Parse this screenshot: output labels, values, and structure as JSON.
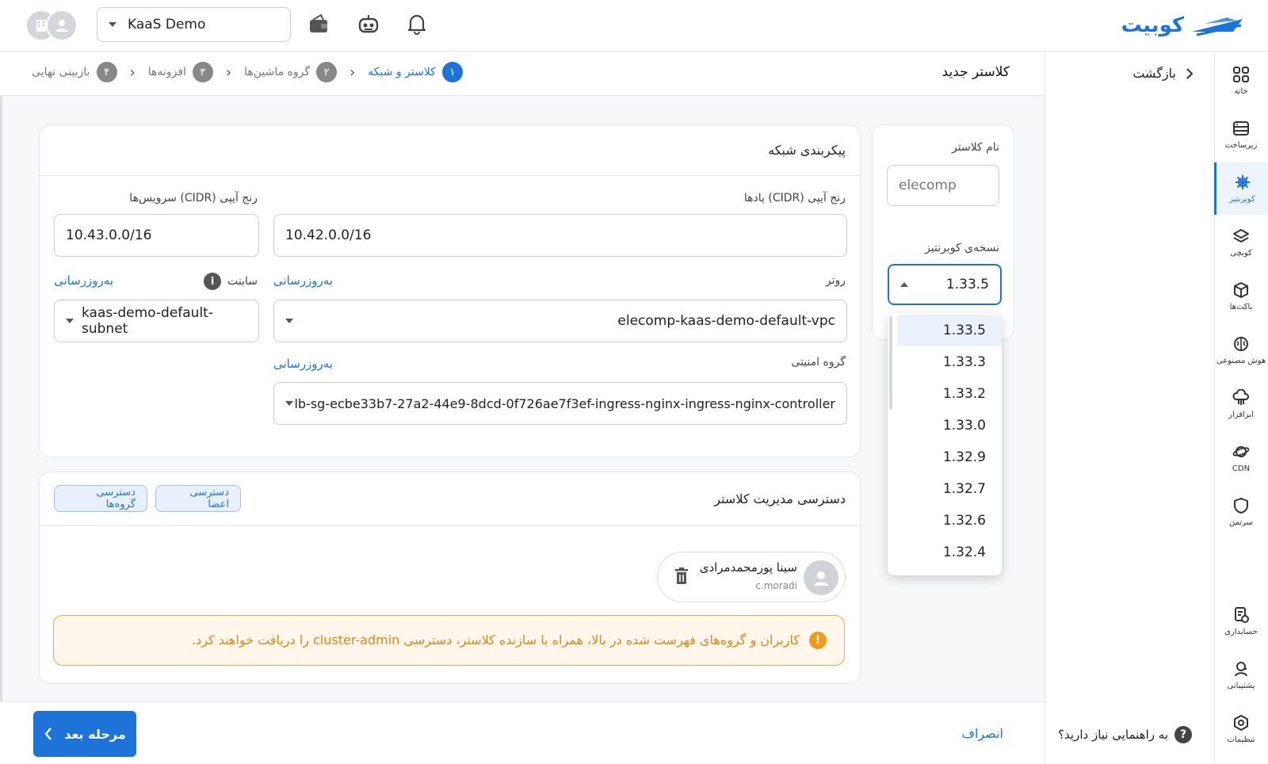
{
  "topbar": {
    "project_select_value": "KaaS Demo",
    "logo_text": "کوبیت"
  },
  "rail": {
    "items": [
      {
        "label": "خانه",
        "icon": "grid-icon"
      },
      {
        "label": "زیرساخت",
        "icon": "server-icon"
      },
      {
        "label": "کوبرنتیز",
        "icon": "helm-icon"
      },
      {
        "label": "کوبچی",
        "icon": "layers-icon"
      },
      {
        "label": "باکت‌ها",
        "icon": "box-icon"
      },
      {
        "label": "هوش مصنوعی",
        "icon": "brain-icon"
      },
      {
        "label": "ابرافزار",
        "icon": "cloud-app-icon"
      },
      {
        "label": "CDN",
        "icon": "planet-icon"
      },
      {
        "label": "سرتمن",
        "icon": "shield-icon"
      },
      {
        "label": "حسابداری",
        "icon": "billing-icon"
      },
      {
        "label": "پشتیبانی",
        "icon": "support-icon"
      },
      {
        "label": "تنظیمات",
        "icon": "settings-icon"
      }
    ],
    "active_index": 2
  },
  "side": {
    "back_label": "بازگشت",
    "help_label": "به راهنمایی نیاز دارید؟",
    "help_badge": "?"
  },
  "header": {
    "title": "کلاستر جدید",
    "steps": [
      {
        "num": "۱",
        "label": "کلاستر و شبکه",
        "active": true
      },
      {
        "num": "۲",
        "label": "گروه ماشین‌ها",
        "active": false
      },
      {
        "num": "۳",
        "label": "افزونه‌ها",
        "active": false
      },
      {
        "num": "۴",
        "label": "بازبینی نهایی",
        "active": false
      }
    ]
  },
  "cluster": {
    "name_label": "نام کلاستر",
    "name_placeholder": "elecomp",
    "version_label": "نسخه‌ی کوبرنتیز",
    "version_value": "1.33.5",
    "version_options": [
      "1.33.5",
      "1.33.3",
      "1.33.2",
      "1.33.0",
      "1.32.9",
      "1.32.7",
      "1.32.6",
      "1.32.4"
    ],
    "version_selected_index": 0
  },
  "network": {
    "title": "پیکربندی شبکه",
    "pods_cidr_label": "رنج آیپی (CIDR) پادها",
    "pods_cidr_value": "10.42.0.0/16",
    "services_cidr_label": "رنج آیپی (CIDR) سرویس‌ها",
    "services_cidr_value": "10.43.0.0/16",
    "router_label": "روتر",
    "router_value": "elecomp-kaas-demo-default-vpc",
    "subnet_label": "سابنت",
    "subnet_value": "kaas-demo-default-subnet",
    "security_group_label": "گروه امنیتی",
    "security_group_value": "lb-sg-ecbe33b7-27a2-44e9-8dcd-0f726ae7f3ef-ingress-nginx-ingress-nginx-controller",
    "refresh_label": "به‌روزرسانی"
  },
  "access": {
    "title": "دسترسی مدیریت کلاستر",
    "members_button": "دسترسی اعضا",
    "groups_button": "دسترسی گروه‌ها",
    "member": {
      "name": "سینا پورمحمدمرادی",
      "username": "c.moradi"
    },
    "alert_text": "کاربران و گروه‌های فهرست شده در بالا، همراه با سازنده کلاستر، دسترسی cluster-admin را دریافت خواهند کرد.",
    "alert_icon": "!"
  },
  "footer": {
    "next_label": "مرحله بعد",
    "cancel_label": "انصراف"
  },
  "colors": {
    "accent": "#1e73d8",
    "warning": "#f39a1e"
  }
}
